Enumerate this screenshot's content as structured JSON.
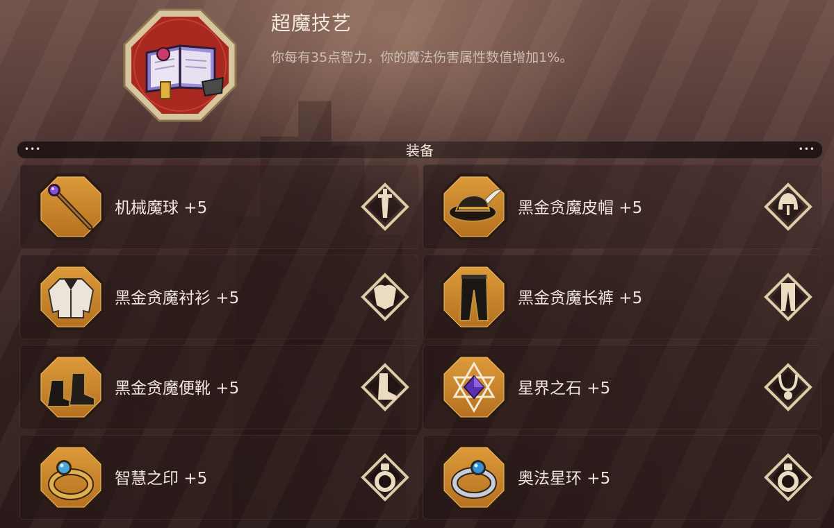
{
  "skill": {
    "title": "超魔技艺",
    "description": "你每有35点智力，你的魔法伤害属性数值增加1%。",
    "icon": "spellbook-icon"
  },
  "section": {
    "title": "装备",
    "left_dots": "•••",
    "right_dots": "•••"
  },
  "items": [
    {
      "name": "机械魔球 +5",
      "icon": "staff-icon",
      "slot_icon": "weapon-slot-icon"
    },
    {
      "name": "黑金贪魔皮帽 +5",
      "icon": "feathered-hat-icon",
      "slot_icon": "helmet-slot-icon"
    },
    {
      "name": "黑金贪魔衬衫 +5",
      "icon": "shirt-icon",
      "slot_icon": "chest-slot-icon"
    },
    {
      "name": "黑金贪魔长裤 +5",
      "icon": "pants-icon",
      "slot_icon": "legs-slot-icon"
    },
    {
      "name": "黑金贪魔便靴 +5",
      "icon": "boots-icon",
      "slot_icon": "boots-slot-icon"
    },
    {
      "name": "星界之石 +5",
      "icon": "star-gem-icon",
      "slot_icon": "amulet-slot-icon"
    },
    {
      "name": "智慧之印 +5",
      "icon": "gold-ring-icon",
      "slot_icon": "ring-slot-icon"
    },
    {
      "name": "奥法星环 +5",
      "icon": "silver-ring-icon",
      "slot_icon": "ring-slot-icon"
    }
  ],
  "colors": {
    "item_frame": "#c9862a",
    "item_frame_dark": "#9a5e14",
    "badge_gold": "#d9c79a",
    "skill_red": "#b02a22"
  }
}
